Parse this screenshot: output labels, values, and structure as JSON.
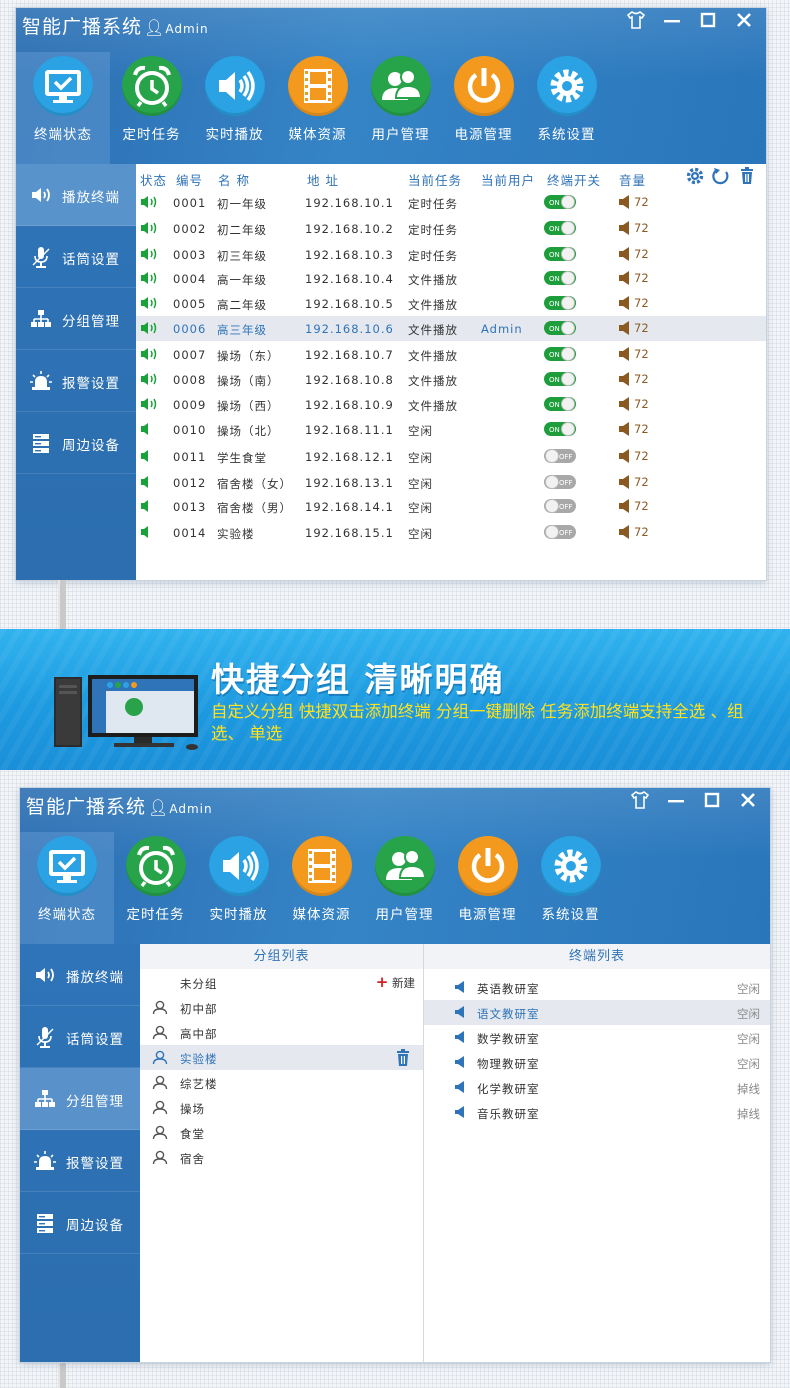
{
  "app": {
    "title": "智能广播系统",
    "user": "Admin",
    "window_controls": [
      "shirt-icon",
      "minimize-icon",
      "maximize-icon",
      "close-icon"
    ]
  },
  "nav": [
    {
      "label": "终端状态",
      "icon": "monitor-icon",
      "color": "#2aa2e3"
    },
    {
      "label": "定时任务",
      "icon": "alarm-clock-icon",
      "color": "#27a34a"
    },
    {
      "label": "实时播放",
      "icon": "speaker-icon",
      "color": "#2aa2e3"
    },
    {
      "label": "媒体资源",
      "icon": "film-icon",
      "color": "#f39a1e"
    },
    {
      "label": "用户管理",
      "icon": "users-icon",
      "color": "#27a34a"
    },
    {
      "label": "电源管理",
      "icon": "power-icon",
      "color": "#f39a1e"
    },
    {
      "label": "系统设置",
      "icon": "gear-icon",
      "color": "#2aa2e3"
    }
  ],
  "sidebar": [
    {
      "label": "播放终端",
      "icon": "speaker-icon"
    },
    {
      "label": "话筒设置",
      "icon": "microphone-icon"
    },
    {
      "label": "分组管理",
      "icon": "group-tree-icon"
    },
    {
      "label": "报警设置",
      "icon": "alarm-light-icon"
    },
    {
      "label": "周边设备",
      "icon": "server-icon"
    }
  ],
  "terminals": {
    "columns": [
      "状态",
      "编号",
      "名 称",
      "地 址",
      "当前任务",
      "当前用户",
      "终端开关",
      "音量"
    ],
    "toolbar": [
      "settings-icon",
      "refresh-icon",
      "delete-icon"
    ],
    "rows": [
      {
        "status": "playing",
        "id": "0001",
        "name": "初一年级",
        "ip": "192.168.10.1",
        "task": "定时任务",
        "user": "",
        "on": true,
        "volume": "72"
      },
      {
        "status": "playing",
        "id": "0002",
        "name": "初二年级",
        "ip": "192.168.10.2",
        "task": "定时任务",
        "user": "",
        "on": true,
        "volume": "72"
      },
      {
        "status": "playing",
        "id": "0003",
        "name": "初三年级",
        "ip": "192.168.10.3",
        "task": "定时任务",
        "user": "",
        "on": true,
        "volume": "72"
      },
      {
        "status": "playing",
        "id": "0004",
        "name": "高一年级",
        "ip": "192.168.10.4",
        "task": "文件播放",
        "user": "",
        "on": true,
        "volume": "72"
      },
      {
        "status": "playing",
        "id": "0005",
        "name": "高二年级",
        "ip": "192.168.10.5",
        "task": "文件播放",
        "user": "",
        "on": true,
        "volume": "72"
      },
      {
        "status": "playing",
        "id": "0006",
        "name": "高三年级",
        "ip": "192.168.10.6",
        "task": "文件播放",
        "user": "Admin",
        "on": true,
        "volume": "72",
        "selected": true
      },
      {
        "status": "playing",
        "id": "0007",
        "name": "操场（东）",
        "ip": "192.168.10.7",
        "task": "文件播放",
        "user": "",
        "on": true,
        "volume": "72"
      },
      {
        "status": "playing",
        "id": "0008",
        "name": "操场（南）",
        "ip": "192.168.10.8",
        "task": "文件播放",
        "user": "",
        "on": true,
        "volume": "72"
      },
      {
        "status": "playing",
        "id": "0009",
        "name": "操场（西）",
        "ip": "192.168.10.9",
        "task": "文件播放",
        "user": "",
        "on": true,
        "volume": "72"
      },
      {
        "status": "idle",
        "id": "0010",
        "name": "操场（北）",
        "ip": "192.168.11.1",
        "task": "空闲",
        "user": "",
        "on": true,
        "volume": "72"
      },
      {
        "status": "idle",
        "id": "0011",
        "name": "学生食堂",
        "ip": "192.168.12.1",
        "task": "空闲",
        "user": "",
        "on": false,
        "volume": "72"
      },
      {
        "status": "idle",
        "id": "0012",
        "name": "宿舍楼（女）",
        "ip": "192.168.13.1",
        "task": "空闲",
        "user": "",
        "on": false,
        "volume": "72"
      },
      {
        "status": "idle",
        "id": "0013",
        "name": "宿舍楼（男）",
        "ip": "192.168.14.1",
        "task": "空闲",
        "user": "",
        "on": false,
        "volume": "72"
      },
      {
        "status": "idle",
        "id": "0014",
        "name": "实验楼",
        "ip": "192.168.15.1",
        "task": "空闲",
        "user": "",
        "on": false,
        "volume": "72"
      }
    ],
    "toggle_on": "ON",
    "toggle_off": "OFF"
  },
  "banner": {
    "heading": "快捷分组  清晰明确",
    "subtitle": "自定义分组  快捷双击添加终端  分组一键删除  任务添加终端支持全选 、组选、 单选"
  },
  "groups": {
    "group_list_title": "分组列表",
    "terminal_list_title": "终端列表",
    "ungrouped_label": "未分组",
    "new_label": "新建",
    "items": [
      {
        "label": "初中部"
      },
      {
        "label": "高中部"
      },
      {
        "label": "实验楼",
        "selected": true
      },
      {
        "label": "综艺楼"
      },
      {
        "label": "操场"
      },
      {
        "label": "食堂"
      },
      {
        "label": "宿舍"
      }
    ],
    "terminals": [
      {
        "name": "英语教研室",
        "status": "空闲"
      },
      {
        "name": "语文教研室",
        "status": "空闲",
        "selected": true
      },
      {
        "name": "数学教研室",
        "status": "空闲"
      },
      {
        "name": "物理教研室",
        "status": "空闲"
      },
      {
        "name": "化学教研室",
        "status": "掉线"
      },
      {
        "name": "音乐教研室",
        "status": "掉线"
      }
    ]
  },
  "colors": {
    "accent": "#2f73b8",
    "playing": "#1aa23a",
    "volume": "#8a5a22",
    "banner_text": "#ffe21a"
  }
}
